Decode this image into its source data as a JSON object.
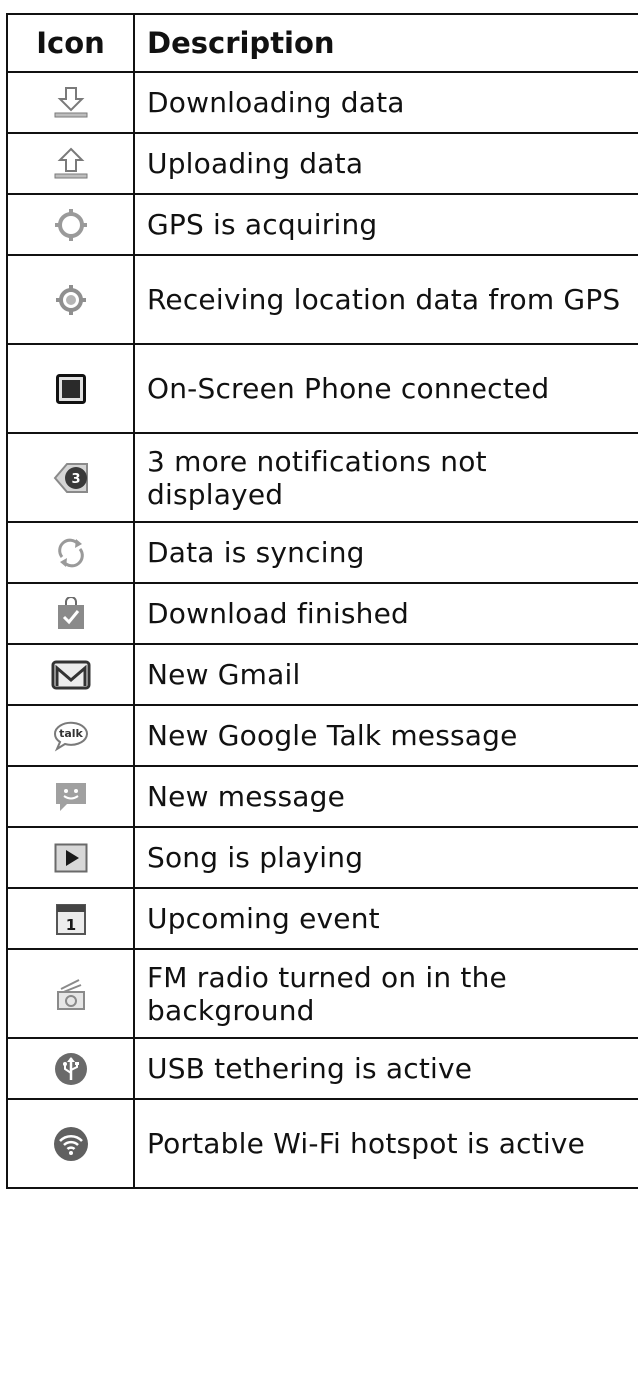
{
  "table": {
    "header": {
      "icon": "Icon",
      "description": "Description"
    },
    "rows": [
      {
        "icon": "download-icon",
        "description": "Downloading data"
      },
      {
        "icon": "upload-icon",
        "description": "Uploading data"
      },
      {
        "icon": "gps-acquiring-icon",
        "description": "GPS is acquiring"
      },
      {
        "icon": "gps-receiving-icon",
        "description": "Receiving location data from GPS"
      },
      {
        "icon": "on-screen-phone-icon",
        "description": "On-Screen Phone connected"
      },
      {
        "icon": "more-notifications-icon",
        "icon_text": "3",
        "description": "3 more notifications not displayed"
      },
      {
        "icon": "sync-icon",
        "description": "Data is syncing"
      },
      {
        "icon": "download-finished-icon",
        "description": "Download finished"
      },
      {
        "icon": "gmail-icon",
        "description": "New Gmail"
      },
      {
        "icon": "google-talk-icon",
        "icon_text": "talk",
        "description": "New Google Talk message"
      },
      {
        "icon": "message-icon",
        "description": "New message"
      },
      {
        "icon": "play-icon",
        "description": "Song is playing"
      },
      {
        "icon": "calendar-icon",
        "icon_text": "1",
        "description": "Upcoming event"
      },
      {
        "icon": "fm-radio-icon",
        "description": "FM radio turned on in the background"
      },
      {
        "icon": "usb-tethering-icon",
        "description": "USB tethering is active"
      },
      {
        "icon": "wifi-hotspot-icon",
        "description": "Portable Wi-Fi hotspot is active"
      }
    ]
  }
}
